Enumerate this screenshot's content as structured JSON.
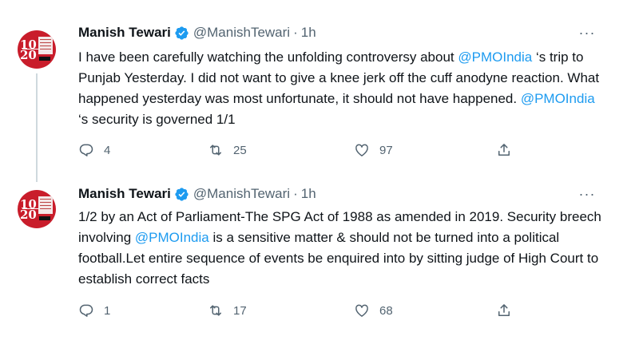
{
  "tweets": [
    {
      "name": "Manish Tewari",
      "handle": "@ManishTewari",
      "dot": "·",
      "time": "1h",
      "text_segments": [
        {
          "t": "I have been carefully watching the unfolding controversy about ",
          "m": false
        },
        {
          "t": "@PMOIndia",
          "m": true
        },
        {
          "t": " ‘s trip to Punjab Yesterday. I did not want to give a knee jerk off the cuff anodyne reaction. What happened yesterday was most unfortunate, it should not have happened. ",
          "m": false
        },
        {
          "t": "@PMOIndia",
          "m": true
        },
        {
          "t": " ‘s security is governed 1/1",
          "m": false
        }
      ],
      "replies": "4",
      "retweets": "25",
      "likes": "97"
    },
    {
      "name": "Manish Tewari",
      "handle": "@ManishTewari",
      "dot": "·",
      "time": "1h",
      "text_segments": [
        {
          "t": "1/2 by an Act of Parliament-The SPG Act of 1988 as amended in 2019. Security breech involving  ",
          "m": false
        },
        {
          "t": "@PMOIndia",
          "m": true
        },
        {
          "t": " is a sensitive matter & should not be turned into a political football.Let entire sequence of events be enquired into by sitting judge of High Court to establish correct facts",
          "m": false
        }
      ],
      "replies": "1",
      "retweets": "17",
      "likes": "68"
    }
  ],
  "avatar": {
    "top_number": "10",
    "bottom_number": "20"
  },
  "icons": {
    "verified": "verified-badge-icon",
    "more": "more-options-icon",
    "reply": "reply-icon",
    "retweet": "retweet-icon",
    "like": "like-icon",
    "share": "share-icon"
  },
  "more_label": "···",
  "colors": {
    "accent": "#1d9bf0",
    "text": "#0f1419",
    "secondary": "#536471",
    "thread_line": "#cfd9de",
    "avatar_bg": "#c91d2b"
  }
}
